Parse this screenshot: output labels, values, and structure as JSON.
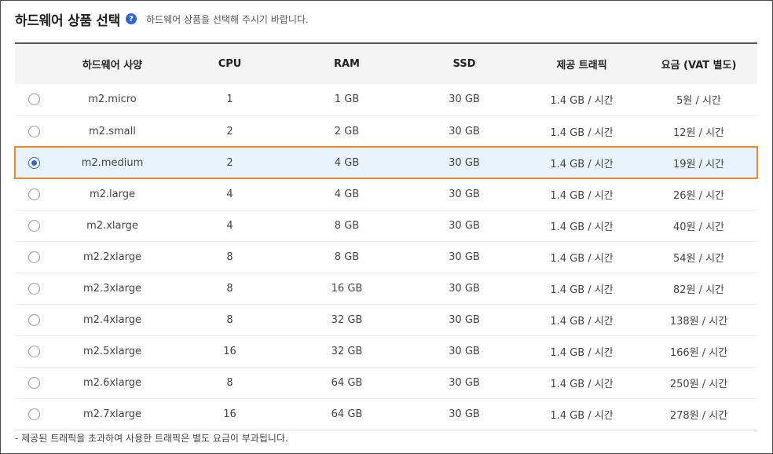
{
  "header": {
    "title": "하드웨어 상품 선택",
    "help_icon": "?",
    "subtitle": "하드웨어 상품을 선택해 주시기 바랍니다."
  },
  "table": {
    "columns": [
      "하드웨어 사양",
      "CPU",
      "RAM",
      "SSD",
      "제공 트래픽",
      "요금 (VAT 별도)"
    ],
    "selected_index": 2,
    "rows": [
      {
        "name": "m2.micro",
        "cpu": "1",
        "ram": "1 GB",
        "ssd": "30 GB",
        "traffic": "1.4 GB / 시간",
        "price": "5원 / 시간"
      },
      {
        "name": "m2.small",
        "cpu": "2",
        "ram": "2 GB",
        "ssd": "30 GB",
        "traffic": "1.4 GB / 시간",
        "price": "12원 / 시간"
      },
      {
        "name": "m2.medium",
        "cpu": "2",
        "ram": "4 GB",
        "ssd": "30 GB",
        "traffic": "1.4 GB / 시간",
        "price": "19원 / 시간"
      },
      {
        "name": "m2.large",
        "cpu": "4",
        "ram": "4 GB",
        "ssd": "30 GB",
        "traffic": "1.4 GB / 시간",
        "price": "26원 / 시간"
      },
      {
        "name": "m2.xlarge",
        "cpu": "4",
        "ram": "8 GB",
        "ssd": "30 GB",
        "traffic": "1.4 GB / 시간",
        "price": "40원 / 시간"
      },
      {
        "name": "m2.2xlarge",
        "cpu": "8",
        "ram": "8 GB",
        "ssd": "30 GB",
        "traffic": "1.4 GB / 시간",
        "price": "54원 / 시간"
      },
      {
        "name": "m2.3xlarge",
        "cpu": "8",
        "ram": "16 GB",
        "ssd": "30 GB",
        "traffic": "1.4 GB / 시간",
        "price": "82원 / 시간"
      },
      {
        "name": "m2.4xlarge",
        "cpu": "8",
        "ram": "32 GB",
        "ssd": "30 GB",
        "traffic": "1.4 GB / 시간",
        "price": "138원 / 시간"
      },
      {
        "name": "m2.5xlarge",
        "cpu": "16",
        "ram": "32 GB",
        "ssd": "30 GB",
        "traffic": "1.4 GB / 시간",
        "price": "166원 / 시간"
      },
      {
        "name": "m2.6xlarge",
        "cpu": "8",
        "ram": "64 GB",
        "ssd": "30 GB",
        "traffic": "1.4 GB / 시간",
        "price": "250원 / 시간"
      },
      {
        "name": "m2.7xlarge",
        "cpu": "16",
        "ram": "64 GB",
        "ssd": "30 GB",
        "traffic": "1.4 GB / 시간",
        "price": "278원 / 시간"
      }
    ]
  },
  "footnote": "- 제공된 트래픽을 초과하여 사용한 트래픽은 별도 요금이 부과됩니다.",
  "colors": {
    "accent": "#2a66d9",
    "selected_border": "#f08a2c",
    "selected_bg": "#e8f2fb"
  }
}
